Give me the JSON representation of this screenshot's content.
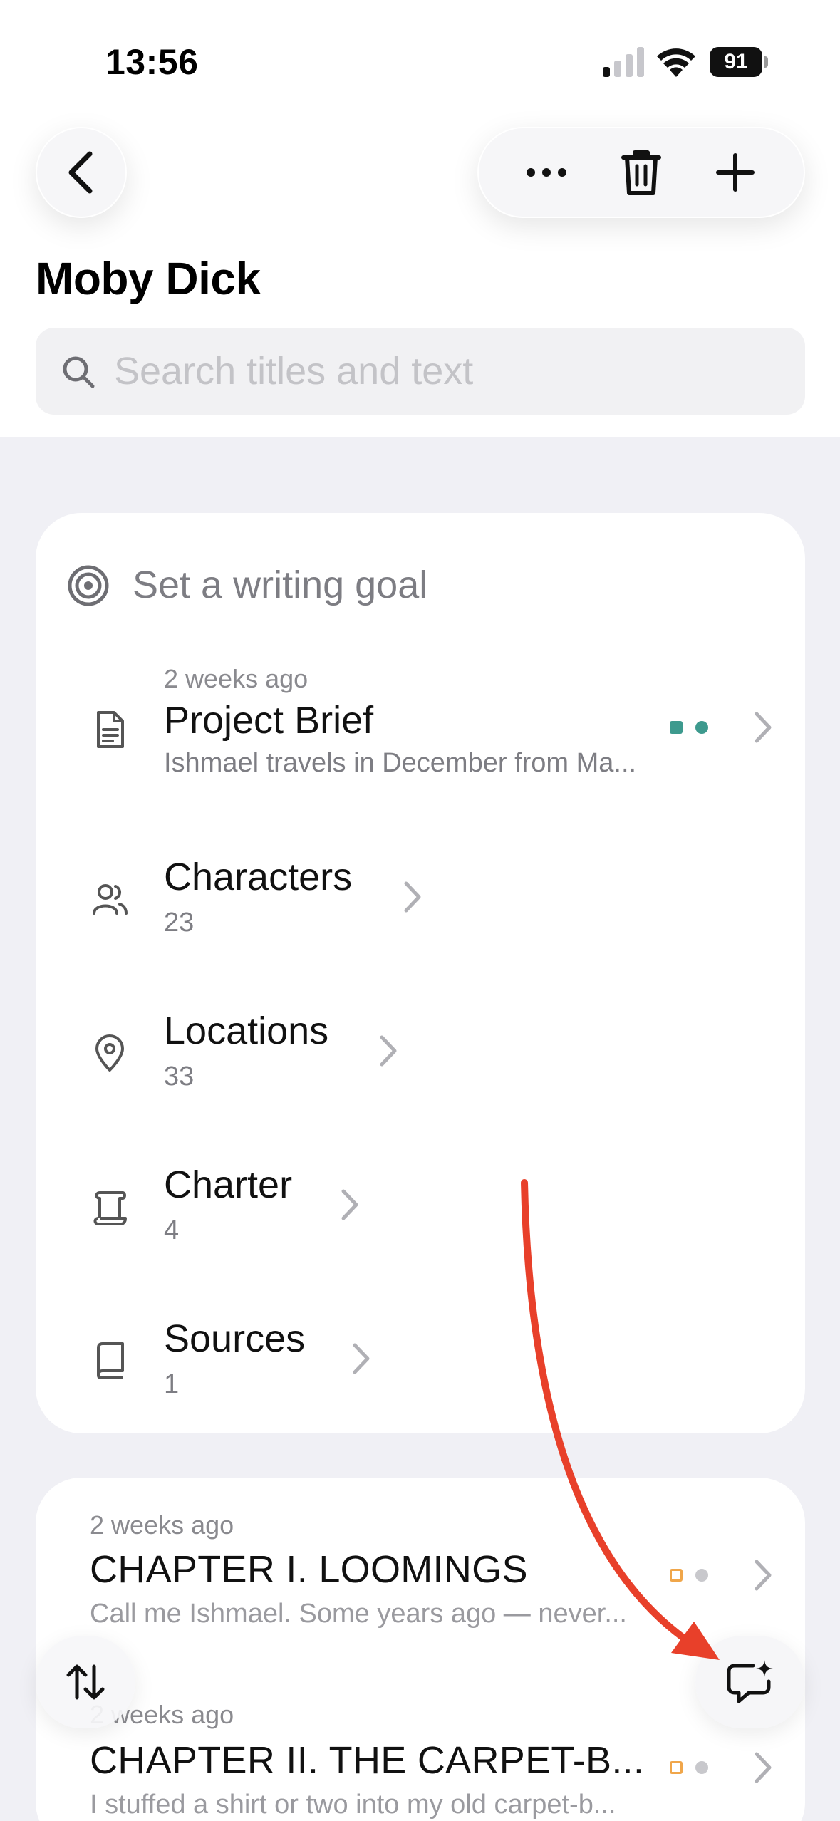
{
  "status_bar": {
    "time": "13:56",
    "battery": "91"
  },
  "header": {
    "title": "Moby Dick"
  },
  "search": {
    "placeholder": "Search titles and text",
    "value": ""
  },
  "overview": {
    "goal_label": "Set a writing goal",
    "project_brief": {
      "meta": "2 weeks ago",
      "title": "Project Brief",
      "snippet": "Ishmael travels in December from Ma...",
      "tag_colors": [
        "#3d9a8e",
        "#3d9a8e"
      ]
    },
    "items": [
      {
        "title": "Characters",
        "count": "23",
        "icon": "people-icon"
      },
      {
        "title": "Locations",
        "count": "33",
        "icon": "map-pin-icon"
      },
      {
        "title": "Charter",
        "count": "4",
        "icon": "scroll-icon"
      },
      {
        "title": "Sources",
        "count": "1",
        "icon": "book-icon"
      }
    ]
  },
  "chapters": [
    {
      "meta": "2 weeks ago",
      "title": "CHAPTER I. LOOMINGS",
      "snippet": "Call me Ishmael. Some years ago — never..."
    },
    {
      "meta": "2 weeks ago",
      "title": "CHAPTER II. THE CARPET-B...",
      "snippet": "I stuffed a shirt or two into my old carpet-b..."
    }
  ],
  "colors": {
    "accent_teal": "#3d9a8e",
    "status_orange": "#f0a64a",
    "annotation_red": "#e8402a"
  }
}
